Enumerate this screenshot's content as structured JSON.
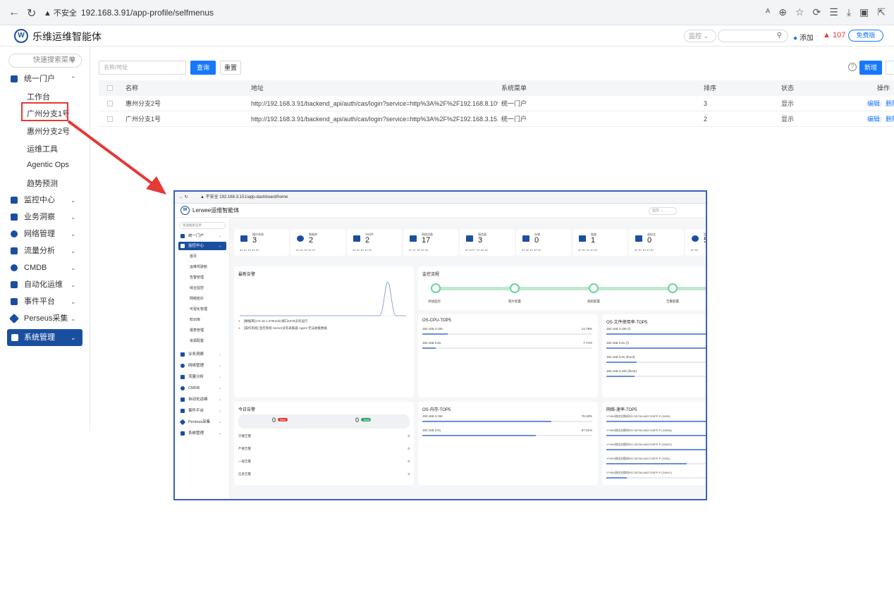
{
  "browser": {
    "insecure": "不安全",
    "url": "192.168.3.91/app-profile/selfmenus"
  },
  "app": {
    "title": "乐维运维智能体",
    "logo_letter": "W"
  },
  "header": {
    "select": "监控",
    "add_label": "添加",
    "alert_count": "107",
    "badge": "免费版"
  },
  "sidebar": {
    "search_placeholder": "快速搜索菜单",
    "groups": [
      {
        "label": "统一门户",
        "expanded": true,
        "children": [
          "工作台",
          "广州分支1号",
          "惠州分支2号",
          "运维工具",
          "Agentic Ops",
          "趋势预测"
        ]
      },
      {
        "label": "监控中心"
      },
      {
        "label": "业务洞察"
      },
      {
        "label": "网络管理"
      },
      {
        "label": "流量分析"
      },
      {
        "label": "CMDB"
      },
      {
        "label": "自动化运维"
      },
      {
        "label": "事件平台"
      },
      {
        "label": "Perseus采集"
      },
      {
        "label": "系统管理",
        "active": true
      }
    ]
  },
  "toolbar": {
    "search_placeholder": "名称/地址",
    "query": "查询",
    "reset": "重置",
    "new": "新增"
  },
  "table": {
    "headers": [
      "名称",
      "地址",
      "系统菜单",
      "排序",
      "状态",
      "操作"
    ],
    "rows": [
      {
        "name": "惠州分支2号",
        "url": "http://192.168.3.91/backend_api/auth/cas/login?service=http%3A%2F%2F192.168.8.109%2Fb...",
        "menu": "统一门户",
        "order": "3",
        "status": "显示",
        "op1": "编辑",
        "op2": "删除"
      },
      {
        "name": "广州分支1号",
        "url": "http://192.168.3.91/backend_api/auth/cas/login?service=http%3A%2F%2F192.168.3.151%2Fb...",
        "menu": "统一门户",
        "order": "2",
        "status": "显示",
        "op1": "编辑",
        "op2": "删除"
      }
    ]
  },
  "inner": {
    "insecure": "不安全",
    "url": "192.168.3.151/app-dashboard/home",
    "title": "Lerwee运维智能体",
    "select": "监控",
    "sidebar_search": "快速搜索菜单",
    "menu": [
      "统一门户",
      "监控中心",
      "业务洞察",
      "网络管理",
      "流量分析",
      "CMDB",
      "自动化运维",
      "事件平台",
      "Perseus采集",
      "系统管理"
    ],
    "submenu": [
      "首页",
      "运维驾驶舱",
      "告警管理",
      "综合监控",
      "网络拓扑",
      "可视化管理",
      "知识库",
      "报表管理",
      "资源配置"
    ],
    "stats": [
      {
        "label": "操作系统",
        "value": "3"
      },
      {
        "label": "数据库",
        "value": "2"
      },
      {
        "label": "中间件",
        "value": "2"
      },
      {
        "label": "网络设备",
        "value": "17"
      },
      {
        "label": "服务器",
        "value": "3"
      },
      {
        "label": "存储",
        "value": "0"
      },
      {
        "label": "链路",
        "value": "1"
      },
      {
        "label": "虚拟化",
        "value": "0"
      },
      {
        "label": "容器",
        "value": "5"
      }
    ],
    "alarm_title": "最新告警",
    "alarms": [
      "[数据库]172.16.1.379redis:端口6379没有运行",
      "[操作系统] 监控系统 Server没有采集器 Agent 无法收集数据"
    ],
    "flow_title": "监控流程",
    "flow_steps": [
      "添加监控",
      "簇片配置",
      "规则配置",
      "告警配置"
    ],
    "cpu": {
      "title": "OS-CPU-TOP5",
      "items": [
        {
          "host": "192.168.3.156",
          "pct": "14.79%",
          "frac": 0.15
        },
        {
          "host": "192.168.3.91",
          "pct": "7.74%",
          "frac": 0.08
        }
      ]
    },
    "disk": {
      "title": "OS-文件使用率-TOP5",
      "items": [
        "192.168.3.156 (/)",
        "192.168.3.91 (/)",
        "192.168.3.91 (/boot)",
        "192.168.3.156 (/boot)"
      ]
    },
    "today": {
      "title": "今日告警",
      "new": "0",
      "new_tag": "New",
      "total": "0",
      "total_tag": "Total",
      "rows": [
        {
          "label": "灾难告警",
          "v": "0"
        },
        {
          "label": "严重告警",
          "v": "0"
        },
        {
          "label": "一般告警",
          "v": "0"
        },
        {
          "label": "信息告警",
          "v": "0"
        }
      ]
    },
    "mem": {
      "title": "OS-内存-TOP5",
      "items": [
        {
          "host": "192.168.3.156",
          "pct": "76.18%",
          "frac": 0.76
        },
        {
          "host": "192.168.3.91",
          "pct": "67.31%",
          "frac": 0.67
        }
      ]
    },
    "net": {
      "title": "网络-速率-TOP5",
      "items": [
        "YYWH测试交换机RG-S5750-48GT/4SFP-P (Gi0/9)",
        "YYWH测试交换机RG-S5750-48GT/4SFP-P (Gi0/46)",
        "YYWH测试交换机RG-S5750-48GT/4SFP-P (Gi0/22)",
        "YYWH测试交换机RG-S5750-48GT/4SFP-P (Gi0/2)",
        "YYWH测试交换机RG-S5750-48GT/4SFP-P (Gi0/47)"
      ]
    }
  },
  "colors": {
    "brand": "#1a4fa0",
    "primary": "#1677ff",
    "highlight": "#e53935"
  }
}
